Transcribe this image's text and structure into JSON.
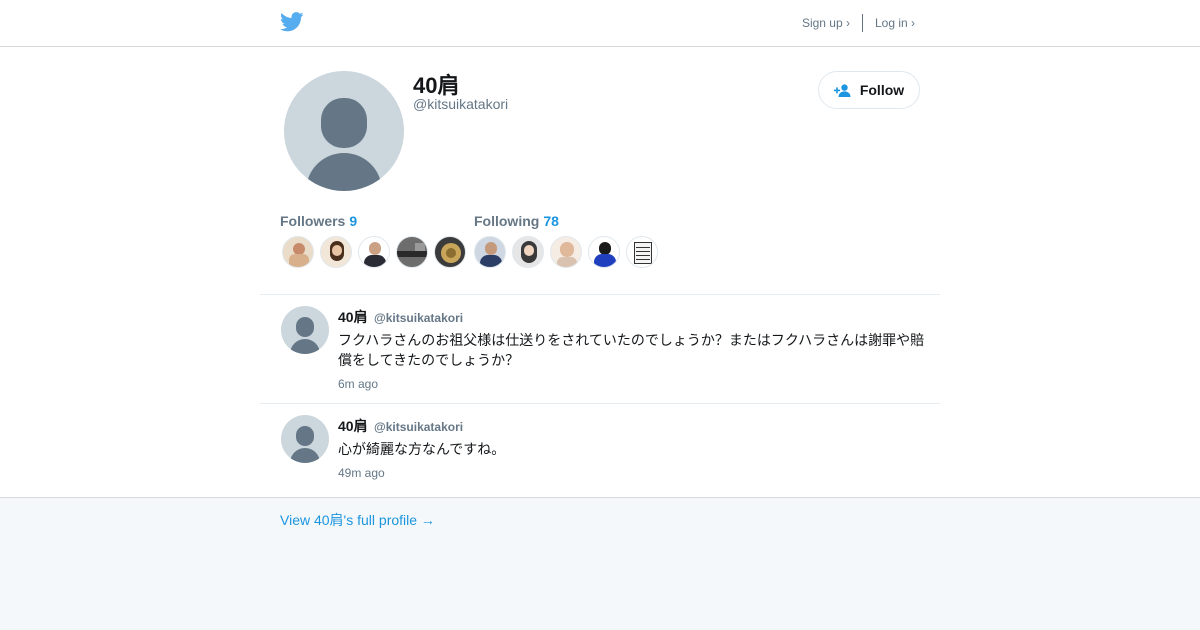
{
  "header": {
    "logo_icon": "twitter-bird-icon",
    "signup_label": "Sign up ›",
    "login_label": "Log in ›"
  },
  "profile": {
    "name": "40肩",
    "handle": "@kitsuikatakori",
    "follow_label": "Follow",
    "follow_icon": "add-person-icon",
    "followers_label": "Followers",
    "followers_count": "9",
    "following_label": "Following",
    "following_count": "78"
  },
  "tweets": [
    {
      "name": "40肩",
      "handle": "@kitsuikatakori",
      "text": "フクハラさんのお祖父様は仕送りをされていたのでしょうか？またはフクハラさんは謝罪や賠償をしてきたのでしょうか？",
      "time": "6m ago"
    },
    {
      "name": "40肩",
      "handle": "@kitsuikatakori",
      "text": "心が綺麗な方なんですね。",
      "time": "49m ago"
    }
  ],
  "footer": {
    "full_profile_link": "View 40肩's full profile →"
  },
  "colors": {
    "accent": "#1b95e0",
    "twitter_blue": "#55acee",
    "muted": "#657786",
    "footer_bg": "#f5f8fa"
  }
}
